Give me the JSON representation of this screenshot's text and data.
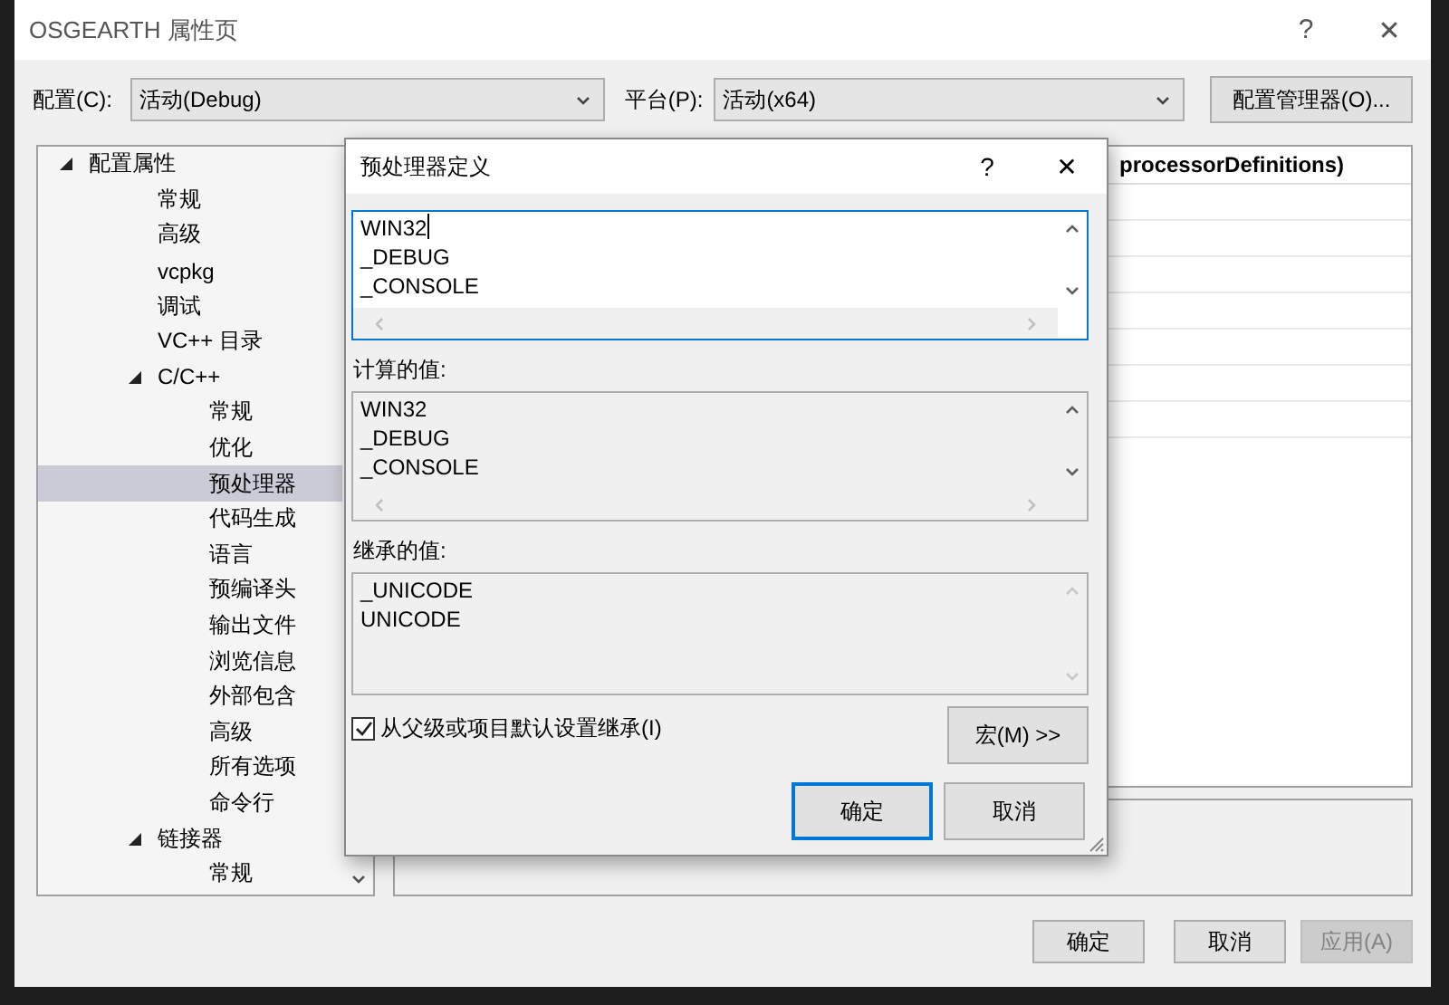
{
  "window": {
    "title": "OSGEARTH 属性页",
    "help": "?",
    "close": "✕"
  },
  "toolbar": {
    "config_label": "配置(C):",
    "config_value": "活动(Debug)",
    "platform_label": "平台(P):",
    "platform_value": "活动(x64)",
    "manager_button": "配置管理器(O)..."
  },
  "tree": [
    {
      "label": "配置属性",
      "expanded": true,
      "selected": false,
      "children": [
        {
          "label": "常规",
          "selected": false
        },
        {
          "label": "高级",
          "selected": false
        },
        {
          "label": "vcpkg",
          "selected": false
        },
        {
          "label": "调试",
          "selected": false
        },
        {
          "label": "VC++ 目录",
          "selected": false
        },
        {
          "label": "C/C++",
          "expanded": true,
          "selected": false,
          "children": [
            {
              "label": "常规",
              "selected": false
            },
            {
              "label": "优化",
              "selected": false
            },
            {
              "label": "预处理器",
              "selected": true
            },
            {
              "label": "代码生成",
              "selected": false
            },
            {
              "label": "语言",
              "selected": false
            },
            {
              "label": "预编译头",
              "selected": false
            },
            {
              "label": "输出文件",
              "selected": false
            },
            {
              "label": "浏览信息",
              "selected": false
            },
            {
              "label": "外部包含",
              "selected": false
            },
            {
              "label": "高级",
              "selected": false
            },
            {
              "label": "所有选项",
              "selected": false
            },
            {
              "label": "命令行",
              "selected": false
            }
          ]
        },
        {
          "label": "链接器",
          "expanded": true,
          "selected": false,
          "children": [
            {
              "label": "常规",
              "selected": false
            }
          ]
        }
      ]
    }
  ],
  "property_header": "processorDefinitions)",
  "buttons": [
    {
      "label": "确定",
      "disabled": false
    },
    {
      "label": "取消",
      "disabled": false
    },
    {
      "label": "应用(A)",
      "disabled": true
    }
  ],
  "dialog": {
    "title": "预处理器定义",
    "help": "?",
    "close": "✕",
    "definitions": [
      "WIN32",
      "_DEBUG",
      "_CONSOLE"
    ],
    "computed_label": "计算的值:",
    "computed": [
      "WIN32",
      "_DEBUG",
      "_CONSOLE"
    ],
    "inherited_label": "继承的值:",
    "inherited": [
      "_UNICODE",
      "UNICODE"
    ],
    "inherit": {
      "label": "从父级或项目默认设置继承(I)",
      "checked": true
    },
    "macro_button": "宏(M) >>",
    "buttons": [
      {
        "label": "确定",
        "primary": true
      },
      {
        "label": "取消",
        "primary": false
      }
    ]
  }
}
